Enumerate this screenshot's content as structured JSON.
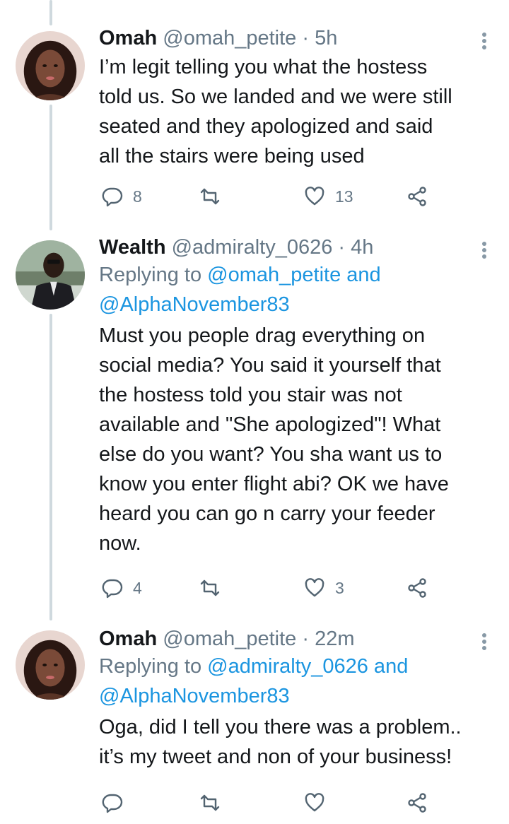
{
  "tweets": [
    {
      "name": "Omah",
      "handle": "@omah_petite",
      "dot": "·",
      "time": "5h",
      "replying_prefix": "",
      "replying_mentions": "",
      "replying_mentions_2": "",
      "body_lines": [
        "I’m legit telling you what the hostess",
        "told us.  So we landed and we were still",
        "seated and they apologized and said",
        "all the stairs were being used"
      ],
      "replies": "8",
      "retweets": "",
      "likes": "13",
      "avatar_icon": "woman-avatar"
    },
    {
      "name": "Wealth",
      "handle": "@admiralty_0626",
      "dot": "·",
      "time": "4h",
      "replying_prefix": "Replying to ",
      "replying_mentions": "@omah_petite and",
      "replying_mentions_2": "@AlphaNovember83",
      "body_lines": [
        "Must you people drag everything on",
        "social media? You said it yourself that",
        "the hostess told you stair was not",
        "available and \"She apologized\"! What",
        "else do you want? You sha want us to",
        "know you enter flight abi? OK we have",
        "heard you can go n carry your feeder",
        "now."
      ],
      "replies": "4",
      "retweets": "",
      "likes": "3",
      "avatar_icon": "man-avatar"
    },
    {
      "name": "Omah",
      "handle": "@omah_petite",
      "dot": "·",
      "time": "22m",
      "replying_prefix": "Replying to ",
      "replying_mentions": "@admiralty_0626 and",
      "replying_mentions_2": "@AlphaNovember83",
      "body_lines": [
        "Oga, did I tell you there was a problem..",
        "it’s my tweet and non of your business!"
      ],
      "replies": "",
      "retweets": "",
      "likes": "",
      "avatar_icon": "woman-avatar"
    }
  ],
  "icons": {
    "reply": "reply-icon",
    "retweet": "retweet-icon",
    "like": "heart-icon",
    "share": "share-icon",
    "more": "more-options-icon"
  },
  "colors": {
    "text": "#14171a",
    "secondary": "#657786",
    "link": "#1b95e0",
    "thread_line": "#cfd9de"
  }
}
